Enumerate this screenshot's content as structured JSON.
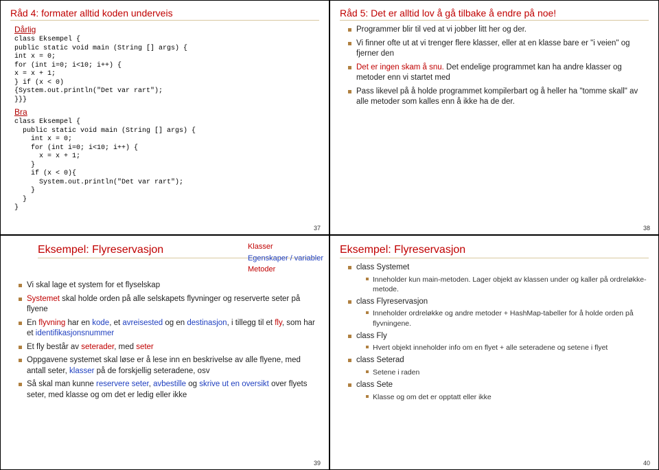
{
  "slides": {
    "s37": {
      "title": "Råd 4: formater alltid koden underveis",
      "bad_label": "Dårlig",
      "good_label": "Bra",
      "code_bad": "class Eksempel {\npublic static void main (String [] args) {\nint x = 0;\nfor (int i=0; i<10; i++) {\nx = x + 1;\n} if (x < 0)\n{System.out.println(\"Det var rart\");\n}}}",
      "code_good": "class Eksempel {\n  public static void main (String [] args) {\n    int x = 0;\n    for (int i=0; i<10; i++) {\n      x = x + 1;\n    }\n    if (x < 0){\n      System.out.println(\"Det var rart\");\n    }\n  }\n}",
      "page": "37"
    },
    "s38": {
      "title": "Råd 5: Det er alltid lov å gå tilbake å endre på noe!",
      "b1": "Programmer blir til ved at vi jobber litt her og der.",
      "b2": "Vi finner ofte ut at vi trenger flere klasser, eller at en klasse bare er \"i veien\" og fjerner den",
      "b3a": "Det er ingen skam å snu.",
      "b3b": " Det endelige programmet kan ha andre klasser og metoder enn vi startet med",
      "b4": "Pass likevel på å holde programmet kompilerbart og å heller ha \"tomme skall\" av alle metoder som kalles enn å ikke ha de der.",
      "page": "38"
    },
    "s39": {
      "title": "Eksempel: Flyreservasjon",
      "legend1": "Klasser",
      "legend2": "Egenskaper / variabler",
      "legend3": "Metoder",
      "b1a": "Vi skal lage et system for et flyselskap",
      "b2_pre": "",
      "b2_red": "Systemet",
      "b2_post": " skal holde orden på alle selskapets flyvninger og reserverte seter på flyene",
      "b3_1": "En ",
      "b3_r1": "flyvning",
      "b3_2": " har en ",
      "b3_b1": "kode",
      "b3_3": ", et ",
      "b3_b2": "avreisested",
      "b3_4": " og en ",
      "b3_b3": "destinasjon",
      "b3_5": ", i tillegg til et ",
      "b3_r2": "fly",
      "b3_6": ", som har et ",
      "b3_b4": "identifikasjonsnummer",
      "b4_1": "Et fly består av ",
      "b4_r1": "seterader",
      "b4_2": ", med ",
      "b4_r2": "seter",
      "b5_1": "Oppgavene systemet skal løse er å lese inn en beskrivelse av alle flyene, med antall seter, ",
      "b5_b1": "klasser",
      "b5_2": " på de forskjellig seteradene, osv",
      "b6_1": "Så skal man kunne ",
      "b6_b1": "reservere seter",
      "b6_2": ", ",
      "b6_b2": "avbestille",
      "b6_3": " og ",
      "b6_b3": "skrive ut en oversikt",
      "b6_4": " over flyets seter, med klasse og om det er ledig eller ikke",
      "page": "39"
    },
    "s40": {
      "title": "Eksempel: Flyreservasjon",
      "i1": "class Systemet",
      "i1s": "Inneholder kun main-metoden. Lager objekt av klassen under og kaller på ordreløkke-metode.",
      "i2": "class Flyreservasjon",
      "i2s": "Inneholder ordreløkke og andre metoder + HashMap-tabeller for å holde orden på flyvningene.",
      "i3": "class Fly",
      "i3s": "Hvert objekt inneholder info om en flyet + alle seteradene og setene i flyet",
      "i4": "class Seterad",
      "i4s": "Setene i raden",
      "i5": "class Sete",
      "i5s": "Klasse og om det er opptatt eller ikke",
      "page": "40"
    }
  }
}
